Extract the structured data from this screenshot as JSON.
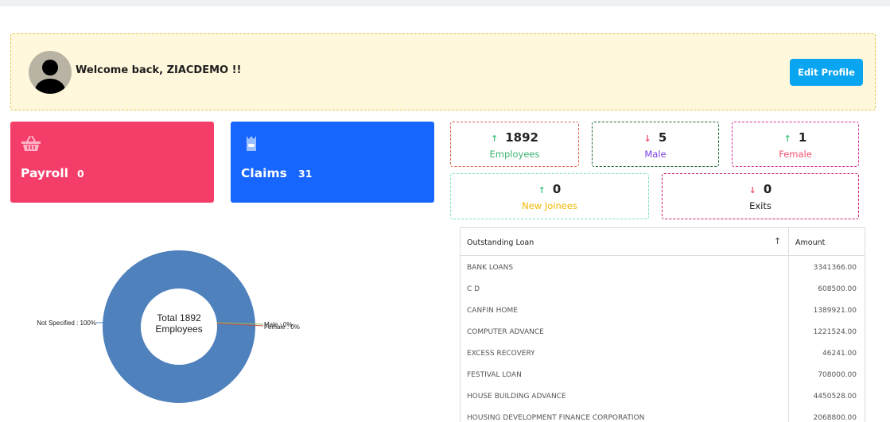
{
  "welcome": {
    "message": "Welcome back, ZIACDEMO !!",
    "edit_profile_label": "Edit Profile"
  },
  "tiles": {
    "payroll": {
      "label": "Payroll",
      "value": "0",
      "icon": "basket-icon"
    },
    "claims": {
      "label": "Claims",
      "value": "31",
      "icon": "claims-icon"
    }
  },
  "stats": {
    "employees": {
      "value": "1892",
      "label": "Employees",
      "trend": "up"
    },
    "male": {
      "value": "5",
      "label": "Male",
      "trend": "down"
    },
    "female": {
      "value": "1",
      "label": "Female",
      "trend": "up"
    },
    "new_joinees": {
      "value": "0",
      "label": "New Joinees",
      "trend": "up"
    },
    "exits": {
      "value": "0",
      "label": "Exits",
      "trend": "down"
    }
  },
  "chart_data": {
    "type": "pie",
    "center_text": [
      "Total 1892",
      "Employees"
    ],
    "slices": [
      {
        "label": "Not Specified : 100%",
        "value": 100,
        "color": "#4f81bd"
      },
      {
        "label": "Male : 0%",
        "value": 0,
        "color": "#9bbb59"
      },
      {
        "label": "Female : 0%",
        "value": 0,
        "color": "#c0504d"
      }
    ]
  },
  "loan_table": {
    "columns": [
      "Outstanding Loan",
      "Amount"
    ],
    "rows": [
      [
        "BANK LOANS",
        "3341366.00"
      ],
      [
        "C D",
        "608500.00"
      ],
      [
        "CANFIN HOME",
        "1389921.00"
      ],
      [
        "COMPUTER ADVANCE",
        "1221524.00"
      ],
      [
        "EXCESS RECOVERY",
        "46241.00"
      ],
      [
        "FESTIVAL LOAN",
        "708000.00"
      ],
      [
        "HOUSE BUILDING ADVANCE",
        "4450528.00"
      ],
      [
        "HOUSING DEVELOPMENT FINANCE CORPORATION",
        "2068800.00"
      ]
    ]
  },
  "colors": {
    "payroll": "#f53d6a",
    "claims": "#1766ff",
    "employees_border": "#e0624a",
    "male_border": "#1b6b2e",
    "female_border": "#d62e9a",
    "new_joinees_border": "#7fe0c8",
    "exits_border": "#c8176c",
    "employees_label": "#3cb371",
    "male_label": "#7b3fe4",
    "female_label": "#f0506e",
    "new_joinees_label": "#f2b700",
    "exits_label": "#222222"
  }
}
